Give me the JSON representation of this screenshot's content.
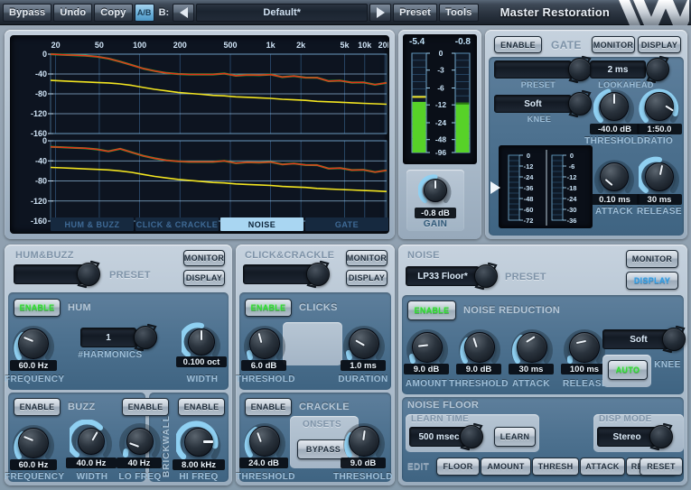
{
  "toolbar": {
    "bypass": "Bypass",
    "undo": "Undo",
    "copy": "Copy",
    "ab": "A/B",
    "b_label": "B:",
    "preset_value": "Default*",
    "preset": "Preset",
    "tools": "Tools",
    "brand": "Master Restoration",
    "prev_icon": "triangle-left-icon",
    "next_icon": "triangle-right-icon",
    "logo_icon": "waves-logo-icon"
  },
  "graph": {
    "x_ticks": [
      "20",
      "50",
      "100",
      "200",
      "500",
      "1k",
      "2k",
      "5k",
      "10k",
      "20k"
    ],
    "y_ticks": [
      "0",
      "-40",
      "-80",
      "-120",
      "-160"
    ],
    "tabs": [
      {
        "label": "HUM & BUZZ",
        "active": false
      },
      {
        "label": "CLICK & CRACKLE",
        "active": false
      },
      {
        "label": "NOISE",
        "active": true
      },
      {
        "label": "GATE",
        "active": false
      }
    ],
    "curve_colors": {
      "input": "#e8301a",
      "floor": "#f2e420",
      "reduction": "#29c43a"
    }
  },
  "meters": {
    "left_value": "-5.4",
    "right_value": "-0.8",
    "scale": [
      "0",
      "-3",
      "-6",
      "-12",
      "-24",
      "-48",
      "-96"
    ],
    "gain_value": "-0.8 dB",
    "gain_label": "GAIN"
  },
  "gate": {
    "enable": "ENABLE",
    "title": "GATE",
    "monitor": "MONITOR",
    "display": "DISPLAY",
    "preset_value": "",
    "preset_label": "PRESET",
    "lookahead_value": "2 ms",
    "lookahead_label": "LOOKAHEAD",
    "knee_value": "Soft",
    "knee_label": "KNEE",
    "threshold_value": "-40.0 dB",
    "threshold_label": "THRESHOLD",
    "ratio_value": "1:50.0",
    "ratio_label": "RATIO",
    "attack_value": "0.10 ms",
    "attack_label": "ATTACK",
    "release_value": "30 ms",
    "release_label": "RELEASE",
    "meter_scale_left": [
      "0",
      "-12",
      "-24",
      "-36",
      "-48",
      "-60",
      "-72"
    ],
    "meter_scale_right": [
      "0",
      "-6",
      "-12",
      "-18",
      "-24",
      "-30",
      "-36"
    ],
    "pointer_icon": "triangle-right-icon"
  },
  "hum": {
    "title": "HUM&BUZZ",
    "monitor": "MONITOR",
    "display": "DISPLAY",
    "preset_value": "",
    "preset_label": "PRESET",
    "hum_enable": "ENABLE",
    "hum_title": "HUM",
    "frequency_value": "60.0 Hz",
    "frequency_label": "FREQUENCY",
    "harmonics_value": "1",
    "harmonics_label": "#HARMONICS",
    "width_value": "0.100 oct",
    "width_label": "WIDTH",
    "buzz_enable": "ENABLE",
    "buzz_title": "BUZZ",
    "buzz_freq_value": "60.0 Hz",
    "buzz_freq_label": "FREQUENCY",
    "buzz_width_value": "40.0 Hz",
    "buzz_width_label": "WIDTH",
    "brickwall_title": "BRICKWALL",
    "lo_enable": "ENABLE",
    "lo_freq_value": "40 Hz",
    "lo_freq_label": "LO FREQ",
    "hi_enable": "ENABLE",
    "hi_freq_value": "8.00 kHz",
    "hi_freq_label": "HI FREQ"
  },
  "click": {
    "title": "CLICK&CRACKLE",
    "monitor": "MONITOR",
    "display": "DISPLAY",
    "preset_value": "",
    "clicks_enable": "ENABLE",
    "clicks_title": "CLICKS",
    "threshold_value": "6.0 dB",
    "threshold_label": "THRESHOLD",
    "duration_value": "1.0 ms",
    "duration_label": "DURATION",
    "crackle_enable": "ENABLE",
    "crackle_title": "CRACKLE",
    "crackle_threshold_value": "24.0 dB",
    "crackle_threshold_label": "THRESHOLD",
    "onsets_title": "ONSETS",
    "bypass": "BYPASS",
    "onsets_threshold_value": "9.0 dB",
    "onsets_threshold_label": "THRESHOLD"
  },
  "noise": {
    "title": "NOISE",
    "monitor": "MONITOR",
    "display": "DISPLAY",
    "preset_value": "LP33 Floor*",
    "preset_label": "PRESET",
    "enable": "ENABLE",
    "nr_title": "NOISE REDUCTION",
    "amount_value": "9.0 dB",
    "amount_label": "AMOUNT",
    "threshold_value": "9.0 dB",
    "threshold_label": "THRESHOLD",
    "attack_value": "30 ms",
    "attack_label": "ATTACK",
    "release_value": "100 ms",
    "release_label": "RELEASE",
    "knee_value": "Soft",
    "knee_label": "KNEE",
    "auto": "AUTO",
    "floor_title": "NOISE FLOOR",
    "learn_time_label": "LEARN TIME",
    "learn_time_value": "500 msec",
    "learn": "LEARN",
    "disp_mode_label": "DISP MODE",
    "disp_mode_value": "Stereo",
    "edit_label": "EDIT",
    "edit_buttons": [
      "FLOOR",
      "AMOUNT",
      "THRESH",
      "ATTACK",
      "RELEASE"
    ],
    "reset": "RESET"
  }
}
